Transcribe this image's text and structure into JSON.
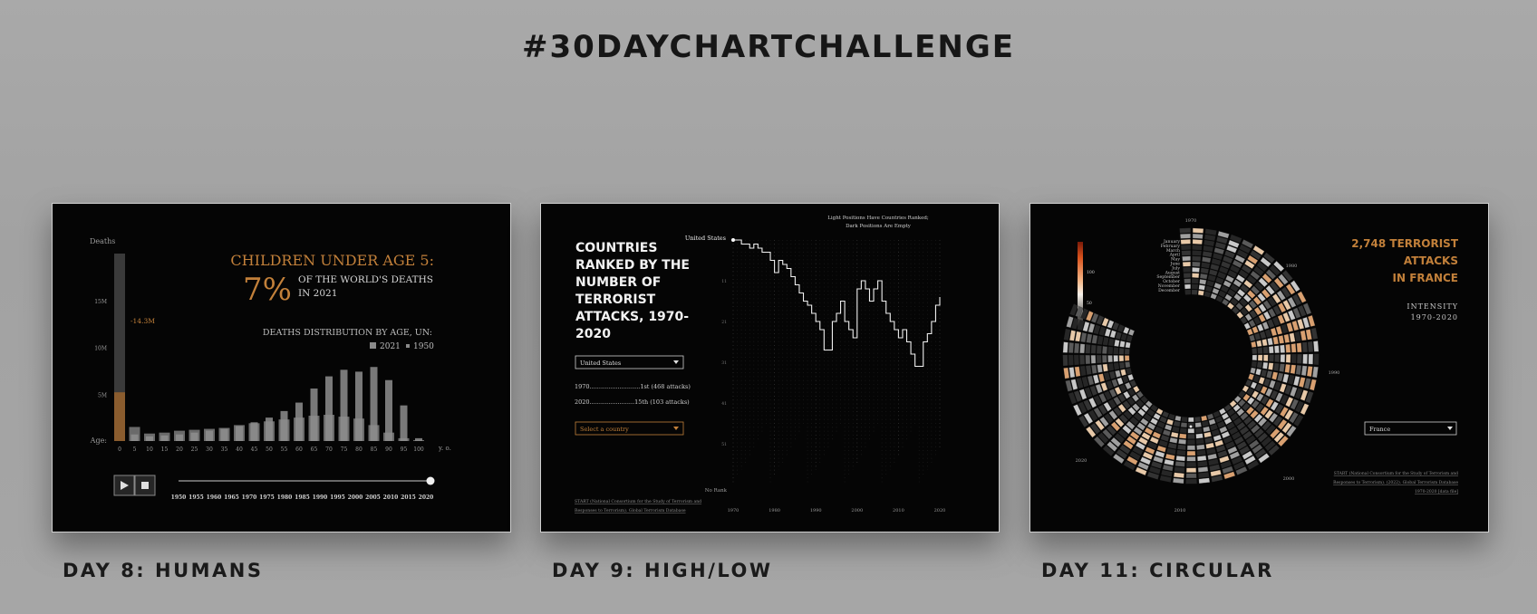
{
  "page": {
    "title": "#30DAYCHARTCHALLENGE"
  },
  "colors": {
    "accent": "#c2803a",
    "background": "#a6a6a6",
    "card": "#050505"
  },
  "cards": [
    {
      "caption": "DAY 8: HUMANS",
      "chart_data": {
        "type": "bar",
        "title": "CHILDREN UNDER AGE 5:",
        "highlight": "7%",
        "highlight_text_1": "OF THE WORLD'S DEATHS",
        "highlight_text_2": "IN 2021",
        "subtitle": "DEATHS DISTRIBUTION BY AGE, UN:",
        "ylabel": "Deaths",
        "xlabel": "Age:",
        "x_unit": "y. o.",
        "annotation": "-14.3M",
        "y_ticks": [
          "15M",
          "10M",
          "5M"
        ],
        "ylim": [
          0,
          20
        ],
        "categories": [
          "0",
          "5",
          "10",
          "15",
          "20",
          "25",
          "30",
          "35",
          "40",
          "45",
          "50",
          "55",
          "60",
          "65",
          "70",
          "75",
          "80",
          "85",
          "90",
          "95",
          "100"
        ],
        "series": [
          {
            "name": "2021",
            "values": [
              5.2,
              0.7,
              0.5,
              0.6,
              0.7,
              0.9,
              1.1,
              1.3,
              1.6,
              2.0,
              2.5,
              3.2,
              4.1,
              5.6,
              6.9,
              7.6,
              7.4,
              7.9,
              6.5,
              3.8,
              0.3
            ]
          },
          {
            "name": "1950",
            "values": [
              20.0,
              1.5,
              0.8,
              0.9,
              1.1,
              1.2,
              1.3,
              1.4,
              1.7,
              1.9,
              2.1,
              2.3,
              2.5,
              2.7,
              2.8,
              2.6,
              2.4,
              1.7,
              0.9,
              0.3,
              0.1
            ]
          }
        ],
        "timeline": {
          "years": [
            "1950",
            "1955",
            "1960",
            "1965",
            "1970",
            "1975",
            "1980",
            "1985",
            "1990",
            "1995",
            "2000",
            "2005",
            "2010",
            "2015",
            "2020"
          ],
          "current": "2020"
        }
      },
      "controls": {
        "play_icon": "play-icon",
        "stop_icon": "stop-icon"
      }
    },
    {
      "caption": "DAY 9: HIGH/LOW",
      "chart_data": {
        "type": "line",
        "title": "COUNTRIES RANKED BY THE NUMBER OF TERRORIST ATTACKS, 1970-2020",
        "title_lines": [
          "COUNTRIES",
          "RANKED BY THE",
          "NUMBER OF",
          "TERRORIST",
          "ATTACKS, 1970-",
          "2020"
        ],
        "note_line_1": "Light Positions Have Countries Ranked;",
        "note_line_2": "Dark Positions Are Empty",
        "series_label": "United States",
        "bottom_label": "No Rank",
        "y_ticks": [
          "11",
          "21",
          "31",
          "41",
          "51"
        ],
        "x_ticks": [
          "1970",
          "1980",
          "1990",
          "2000",
          "2010",
          "2020"
        ],
        "x": [
          1970,
          1971,
          1972,
          1973,
          1974,
          1975,
          1976,
          1977,
          1978,
          1979,
          1980,
          1981,
          1982,
          1983,
          1984,
          1985,
          1986,
          1987,
          1988,
          1989,
          1990,
          1991,
          1992,
          1993,
          1994,
          1995,
          1996,
          1997,
          1998,
          1999,
          2000,
          2001,
          2002,
          2003,
          2004,
          2005,
          2006,
          2007,
          2008,
          2009,
          2010,
          2011,
          2012,
          2013,
          2014,
          2015,
          2016,
          2017,
          2018,
          2019,
          2020
        ],
        "ranks": [
          1,
          1,
          2,
          2,
          3,
          2,
          3,
          4,
          4,
          6,
          9,
          6,
          7,
          8,
          10,
          12,
          14,
          16,
          17,
          19,
          21,
          23,
          28,
          28,
          21,
          19,
          16,
          21,
          23,
          25,
          13,
          11,
          13,
          16,
          13,
          11,
          16,
          19,
          21,
          23,
          25,
          23,
          26,
          29,
          32,
          32,
          26,
          24,
          21,
          17,
          15
        ],
        "controls": {
          "country_select": "United States",
          "stat_line_1": "1970...........................1st (468 attacks)",
          "stat_line_2": "2020........................15th (103 attacks)",
          "compare_placeholder": "Select a country"
        },
        "source_line_1": "START (National Consortium for the Study of Terrorism and",
        "source_line_2": "Responses to Terrorism). Global Terrorism Database"
      }
    },
    {
      "caption": "DAY 11: CIRCULAR",
      "chart_data": {
        "type": "heatmap",
        "title_line_1": "2,748 TERRORIST",
        "title_line_2": "ATTACKS",
        "title_line_3": "IN FRANCE",
        "subtitle_line_1": "INTENSITY",
        "subtitle_line_2": "1970-2020",
        "months": [
          "January",
          "February",
          "March",
          "April",
          "May",
          "June",
          "July",
          "August",
          "September",
          "October",
          "November",
          "December"
        ],
        "decade_labels": [
          "1970",
          "1980",
          "1990",
          "2000",
          "2010",
          "2020"
        ],
        "legend_ticks": [
          "100",
          "50"
        ],
        "country_select": "France",
        "source_line_1": "START (National Consortium for the Study of Terrorism and",
        "source_line_2": "Responses to Terrorism). (2022). Global Terrorism Database",
        "source_line_3": "1970-2020 [data file]"
      }
    }
  ]
}
